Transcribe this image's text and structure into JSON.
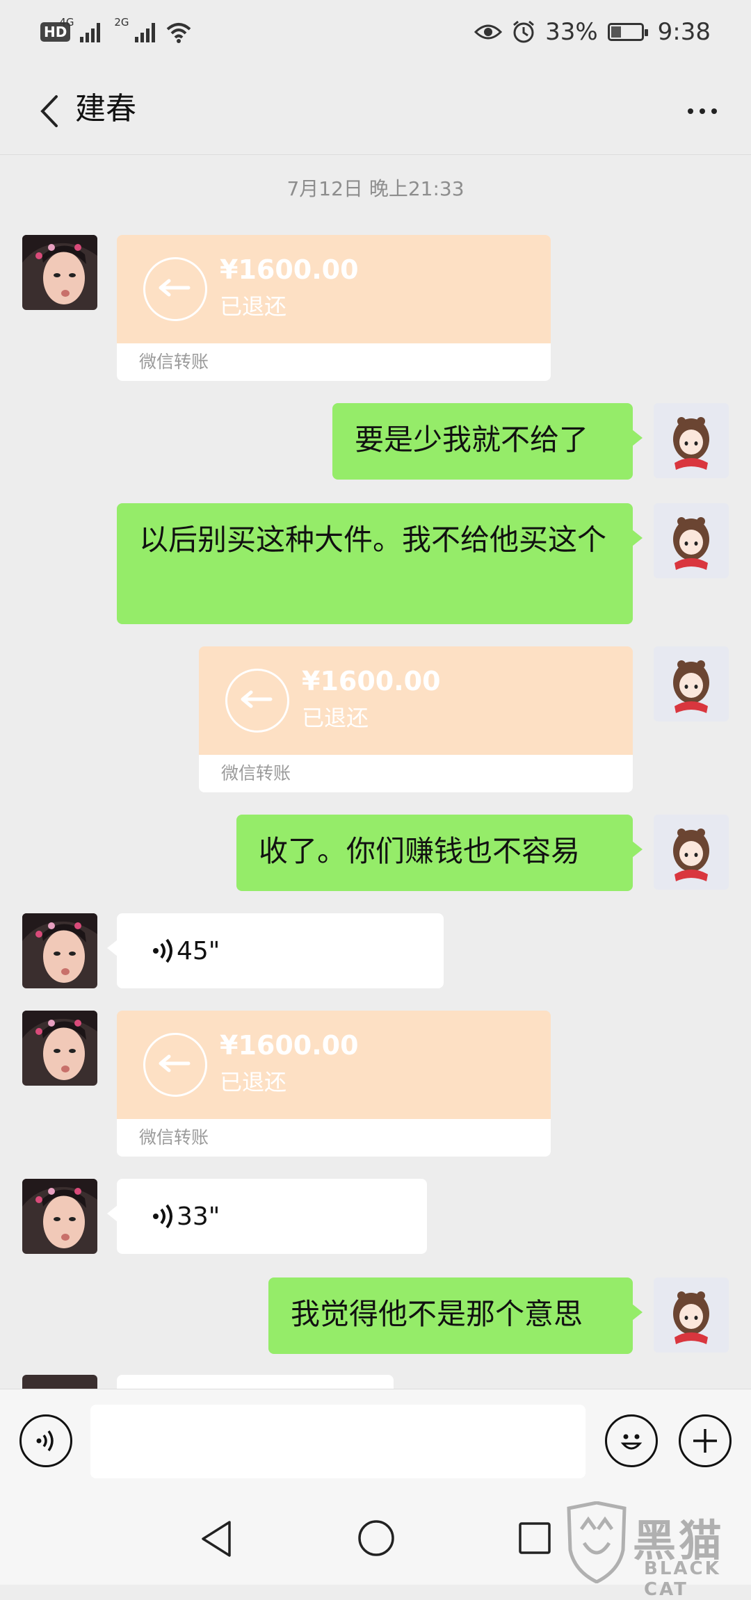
{
  "status_bar": {
    "hd": "HD",
    "net1": "4G",
    "net2": "2G",
    "battery": "33%",
    "battery_level": 0.33,
    "time": "9:38"
  },
  "header": {
    "title": "建春",
    "back_icon": "chevron-left-icon",
    "more_icon": "more-dots-icon"
  },
  "chat": {
    "timestamp": "7月12日 晚上21:33",
    "messages": [
      {
        "sender": "contact",
        "type": "transfer",
        "amount": "¥1600.00",
        "status": "已退还",
        "label": "微信转账"
      },
      {
        "sender": "me",
        "type": "text",
        "text": "要是少我就不给了"
      },
      {
        "sender": "me",
        "type": "text",
        "text": "以后别买这种大件。我不给他买这个"
      },
      {
        "sender": "me",
        "type": "transfer",
        "amount": "¥1600.00",
        "status": "已退还",
        "label": "微信转账"
      },
      {
        "sender": "me",
        "type": "text",
        "text": "收了。你们赚钱也不容易"
      },
      {
        "sender": "contact",
        "type": "voice",
        "duration": "45\""
      },
      {
        "sender": "contact",
        "type": "transfer",
        "amount": "¥1600.00",
        "status": "已退还",
        "label": "微信转账"
      },
      {
        "sender": "contact",
        "type": "voice",
        "duration": "33\""
      },
      {
        "sender": "me",
        "type": "text",
        "text": "我觉得他不是那个意思"
      }
    ]
  },
  "input_bar": {
    "voice_icon": "voice-icon",
    "emoji_icon": "emoji-icon",
    "plus_icon": "plus-icon",
    "value": ""
  },
  "nav_bar": {
    "back_icon": "triangle-back-icon",
    "home_icon": "circle-home-icon",
    "recents_icon": "square-recents-icon"
  },
  "watermark": {
    "big": "黑猫",
    "small": "BLACK CAT"
  }
}
